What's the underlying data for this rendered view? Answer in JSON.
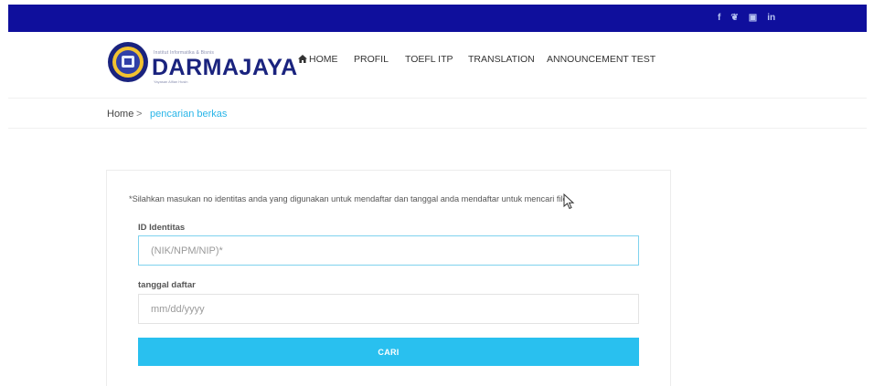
{
  "topbar": {
    "social": [
      {
        "icon": "facebook-icon",
        "glyph": "f"
      },
      {
        "icon": "twitter-icon",
        "glyph": "❦"
      },
      {
        "icon": "instagram-icon",
        "glyph": "▣"
      },
      {
        "icon": "linkedin-icon",
        "glyph": "in"
      }
    ],
    "bg_color": "#0f0f9c"
  },
  "logo": {
    "small_text": "Institut Informatika & Bisnis",
    "title": "DARMAJAYA",
    "sub_text": "Yayasan Alfian Husin"
  },
  "nav": {
    "home": "HOME",
    "profil": "PROFIL",
    "toefl": "TOEFL ITP",
    "translation": "TRANSLATION",
    "announcement": "ANNOUNCEMENT TEST"
  },
  "breadcrumb": {
    "home": "Home",
    "separator": ">",
    "current": "pencarian berkas"
  },
  "form": {
    "note": "*Silahkan masukan no identitas anda yang digunakan untuk mendaftar dan tanggal anda mendaftar untuk mencari file",
    "id_label": "ID Identitas",
    "id_placeholder": "(NIK/NPM/NIP)*",
    "date_label": "tanggal daftar",
    "date_placeholder": "mm/dd/yyyy",
    "submit": "CARI"
  },
  "colors": {
    "accent": "#29c0ef",
    "brand": "#1a237e",
    "link": "#29b5e8"
  }
}
